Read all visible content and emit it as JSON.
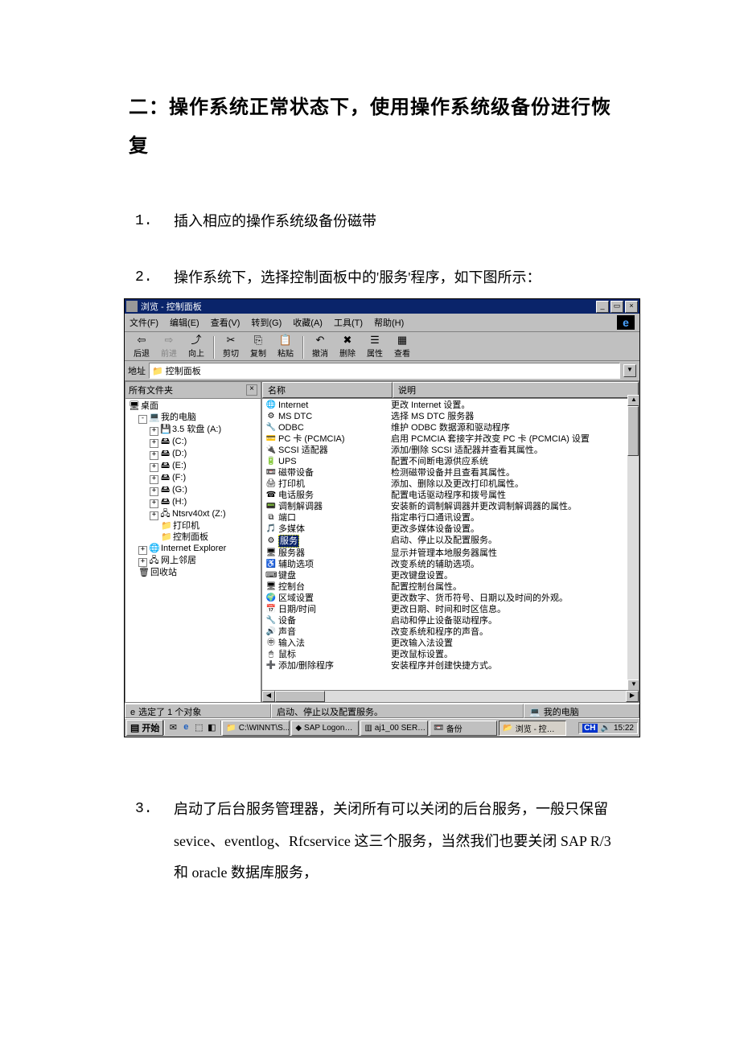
{
  "heading": "二：操作系统正常状态下，使用操作系统级备份进行恢复",
  "items": [
    {
      "num": "1.",
      "text": "插入相应的操作系统级备份磁带"
    },
    {
      "num": "2.",
      "text": "操作系统下，选择控制面板中的'服务'程序，如下图所示："
    },
    {
      "num": "3.",
      "text": "启动了后台服务管理器，关闭所有可以关闭的后台服务，一般只保留 sevice、eventlog、Rfcservice 这三个服务，当然我们也要关闭 SAP R/3 和 oracle 数据库服务，"
    }
  ],
  "win": {
    "title": "浏览 - 控制面板",
    "min": "_",
    "max": "▭",
    "close": "×",
    "menus": [
      "文件(F)",
      "编辑(E)",
      "查看(V)",
      "转到(G)",
      "收藏(A)",
      "工具(T)",
      "帮助(H)"
    ],
    "ie_label": "e",
    "tb": {
      "back": "后退",
      "fwd": "前进",
      "up": "向上",
      "cut": "剪切",
      "copy": "复制",
      "paste": "粘贴",
      "undo": "撤消",
      "del": "删除",
      "prop": "属性",
      "view": "查看"
    },
    "addr_label": "地址",
    "addr_value": "控制面板",
    "tree_title": "所有文件夹",
    "tree": [
      {
        "lvl": 0,
        "exp": "",
        "icon": "🖥",
        "label": "桌面"
      },
      {
        "lvl": 1,
        "exp": "-",
        "icon": "💻",
        "label": "我的电脑"
      },
      {
        "lvl": 2,
        "exp": "+",
        "icon": "💾",
        "label": "3.5 软盘 (A:)"
      },
      {
        "lvl": 2,
        "exp": "+",
        "icon": "🖴",
        "label": "(C:)"
      },
      {
        "lvl": 2,
        "exp": "+",
        "icon": "🖴",
        "label": "(D:)"
      },
      {
        "lvl": 2,
        "exp": "+",
        "icon": "🖴",
        "label": "(E:)"
      },
      {
        "lvl": 2,
        "exp": "+",
        "icon": "🖴",
        "label": "(F:)"
      },
      {
        "lvl": 2,
        "exp": "+",
        "icon": "🖴",
        "label": "(G:)"
      },
      {
        "lvl": 2,
        "exp": "+",
        "icon": "🖴",
        "label": "(H:)"
      },
      {
        "lvl": 2,
        "exp": "+",
        "icon": "🖧",
        "label": "Ntsrv40xt (Z:)"
      },
      {
        "lvl": 3,
        "exp": "",
        "icon": "📁",
        "label": "打印机"
      },
      {
        "lvl": 3,
        "exp": "",
        "icon": "📁",
        "label": "控制面板"
      },
      {
        "lvl": 1,
        "exp": "+",
        "icon": "🌐",
        "label": "Internet Explorer"
      },
      {
        "lvl": 1,
        "exp": "+",
        "icon": "🖧",
        "label": "网上邻居"
      },
      {
        "lvl": 1,
        "exp": "",
        "icon": "🗑",
        "label": "回收站"
      }
    ],
    "col_name": "名称",
    "col_desc": "说明",
    "rows": [
      {
        "icon": "🌐",
        "name": "Internet",
        "desc": "更改 Internet 设置。"
      },
      {
        "icon": "⚙",
        "name": "MS DTC",
        "desc": "选择 MS DTC 服务器"
      },
      {
        "icon": "🔧",
        "name": "ODBC",
        "desc": "维护 ODBC 数据源和驱动程序"
      },
      {
        "icon": "💳",
        "name": "PC 卡 (PCMCIA)",
        "desc": "启用 PCMCIA 套接字并改变 PC 卡 (PCMCIA) 设置"
      },
      {
        "icon": "🔌",
        "name": "SCSI 适配器",
        "desc": "添加/删除 SCSI 适配器并查看其属性。"
      },
      {
        "icon": "🔋",
        "name": "UPS",
        "desc": "配置不间断电源供应系统"
      },
      {
        "icon": "📼",
        "name": "磁带设备",
        "desc": "检测磁带设备并且查看其属性。"
      },
      {
        "icon": "🖨",
        "name": "打印机",
        "desc": "添加、删除以及更改打印机属性。"
      },
      {
        "icon": "☎",
        "name": "电话服务",
        "desc": "配置电话驱动程序和拨号属性"
      },
      {
        "icon": "📟",
        "name": "调制解调器",
        "desc": "安装新的调制解调器并更改调制解调器的属性。"
      },
      {
        "icon": "⧉",
        "name": "端口",
        "desc": "指定串行口通讯设置。"
      },
      {
        "icon": "🎵",
        "name": "多媒体",
        "desc": "更改多媒体设备设置。"
      },
      {
        "icon": "⚙",
        "name": "服务",
        "desc": "启动、停止以及配置服务。",
        "selected": true
      },
      {
        "icon": "🖥",
        "name": "服务器",
        "desc": "显示并管理本地服务器属性"
      },
      {
        "icon": "♿",
        "name": "辅助选项",
        "desc": "改变系统的辅助选项。"
      },
      {
        "icon": "⌨",
        "name": "键盘",
        "desc": "更改键盘设置。"
      },
      {
        "icon": "🖥",
        "name": "控制台",
        "desc": "配置控制台属性。"
      },
      {
        "icon": "🌍",
        "name": "区域设置",
        "desc": "更改数字、货币符号、日期以及时间的外观。"
      },
      {
        "icon": "📅",
        "name": "日期/时间",
        "desc": "更改日期、时间和时区信息。"
      },
      {
        "icon": "🔧",
        "name": "设备",
        "desc": "启动和停止设备驱动程序。"
      },
      {
        "icon": "🔊",
        "name": "声音",
        "desc": "改变系统和程序的声音。"
      },
      {
        "icon": "㊥",
        "name": "输入法",
        "desc": "更改输入法设置"
      },
      {
        "icon": "🖱",
        "name": "鼠标",
        "desc": "更改鼠标设置。"
      },
      {
        "icon": "➕",
        "name": "添加/删除程序",
        "desc": "安装程序并创建快捷方式。"
      }
    ],
    "status1": "选定了 1 个对象",
    "status2": "启动、停止以及配置服务。",
    "status3": "我的电脑",
    "start": "开始",
    "tasks": [
      {
        "icon": "📁",
        "label": "C:\\WINNT\\S..."
      },
      {
        "icon": "◆",
        "label": "SAP Logon…"
      },
      {
        "icon": "▥",
        "label": "aj1_00 SER…"
      },
      {
        "icon": "📼",
        "label": "备份"
      },
      {
        "icon": "📂",
        "label": "浏览 - 控…",
        "active": true
      }
    ],
    "ime": "CH",
    "clock": "15:22"
  }
}
